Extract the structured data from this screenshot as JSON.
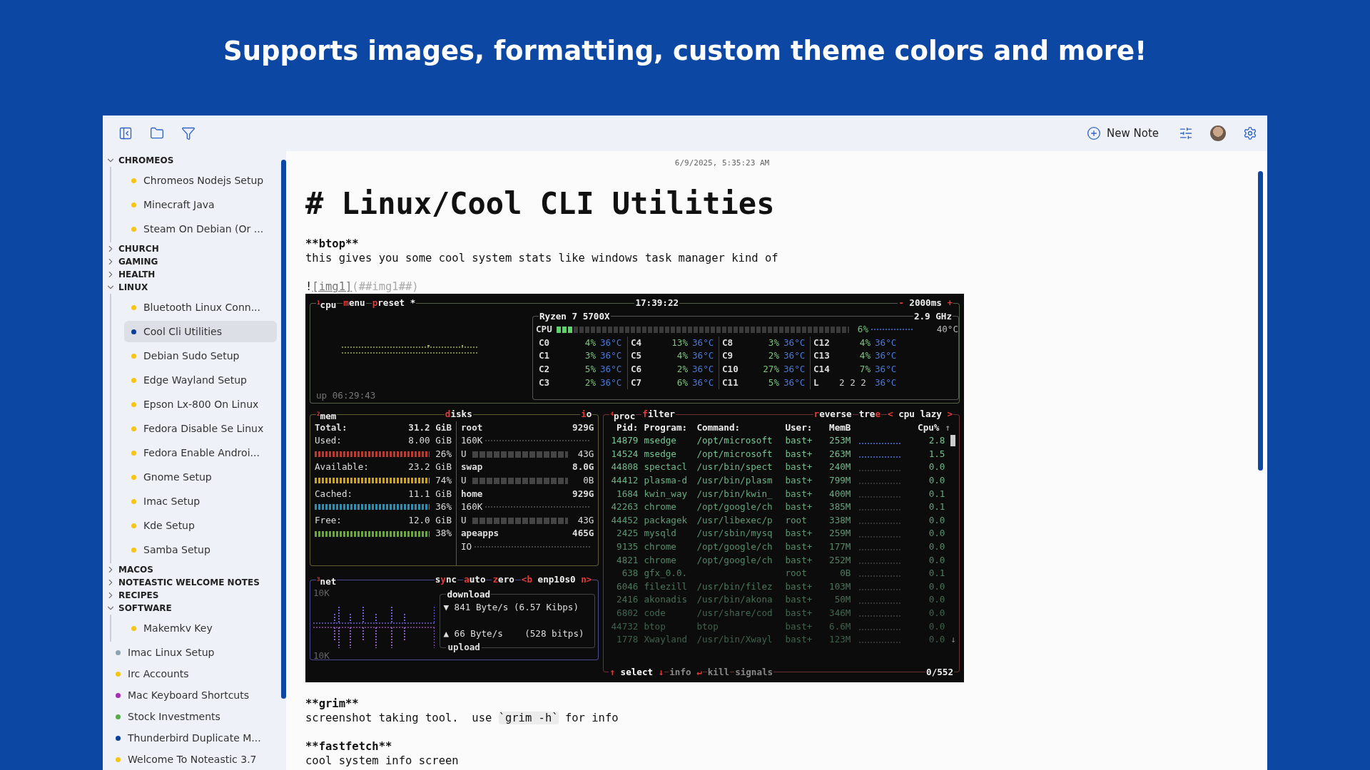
{
  "headline": "Supports images, formatting, custom theme colors and more!",
  "toolbar": {
    "new_note": "New Note"
  },
  "sidebar": {
    "items": [
      {
        "kind": "folder",
        "label": "CHROMEOS",
        "expanded": true,
        "children": [
          {
            "kind": "note",
            "label": "Chromeos Nodejs Setup",
            "color": "#f5c518",
            "selected": false
          },
          {
            "kind": "note",
            "label": "Minecraft Java",
            "color": "#f5c518",
            "selected": false
          },
          {
            "kind": "note",
            "label": "Steam On Debian (Or ...",
            "color": "#f5c518",
            "selected": false
          }
        ]
      },
      {
        "kind": "folder",
        "label": "CHURCH",
        "expanded": false
      },
      {
        "kind": "folder",
        "label": "GAMING",
        "expanded": false
      },
      {
        "kind": "folder",
        "label": "HEALTH",
        "expanded": false
      },
      {
        "kind": "folder",
        "label": "LINUX",
        "expanded": true,
        "children": [
          {
            "kind": "note",
            "label": "Bluetooth Linux Conn...",
            "color": "#f5c518",
            "selected": false
          },
          {
            "kind": "note",
            "label": "Cool Cli Utilities",
            "color": "#0d3f99",
            "selected": true
          },
          {
            "kind": "note",
            "label": "Debian Sudo Setup",
            "color": "#f5c518",
            "selected": false
          },
          {
            "kind": "note",
            "label": "Edge Wayland Setup",
            "color": "#f5c518",
            "selected": false
          },
          {
            "kind": "note",
            "label": "Epson Lx-800 On Linux",
            "color": "#f5c518",
            "selected": false
          },
          {
            "kind": "note",
            "label": "Fedora Disable Se Linux",
            "color": "#f5c518",
            "selected": false
          },
          {
            "kind": "note",
            "label": "Fedora Enable Androi...",
            "color": "#f5c518",
            "selected": false
          },
          {
            "kind": "note",
            "label": "Gnome Setup",
            "color": "#f5c518",
            "selected": false
          },
          {
            "kind": "note",
            "label": "Imac Setup",
            "color": "#f5c518",
            "selected": false
          },
          {
            "kind": "note",
            "label": "Kde Setup",
            "color": "#f5c518",
            "selected": false
          },
          {
            "kind": "note",
            "label": "Samba Setup",
            "color": "#f5c518",
            "selected": false
          }
        ]
      },
      {
        "kind": "folder",
        "label": "MACOS",
        "expanded": false
      },
      {
        "kind": "folder",
        "label": "NOTEASTIC WELCOME NOTES",
        "expanded": false
      },
      {
        "kind": "folder",
        "label": "RECIPES",
        "expanded": false
      },
      {
        "kind": "folder",
        "label": "SOFTWARE",
        "expanded": true,
        "children": [
          {
            "kind": "note",
            "label": "Makemkv Key",
            "color": "#f5c518",
            "selected": false
          }
        ]
      },
      {
        "kind": "note",
        "label": "Imac Linux Setup",
        "color": "#8fa3b3",
        "selected": false
      },
      {
        "kind": "note",
        "label": "Irc Accounts",
        "color": "#f5c518",
        "selected": false
      },
      {
        "kind": "note",
        "label": "Mac Keyboard Shortcuts",
        "color": "#a52fb5",
        "selected": false
      },
      {
        "kind": "note",
        "label": "Stock Investments",
        "color": "#5aaa4a",
        "selected": false
      },
      {
        "kind": "note",
        "label": "Thunderbird Duplicate M...",
        "color": "#0d3f99",
        "selected": false
      },
      {
        "kind": "note",
        "label": "Welcome To Noteastic 3.7",
        "color": "#f5c518",
        "selected": false
      }
    ]
  },
  "note": {
    "timestamp": "6/9/2025, 5:35:23 AM",
    "title": "# Linux/Cool CLI Utilities",
    "blocks": [
      {
        "kind": "bold",
        "text": "**btop**"
      },
      {
        "kind": "text",
        "text": "this gives you some cool system stats like windows task manager kind of"
      },
      {
        "kind": "gap"
      },
      {
        "kind": "image_link",
        "bang": "!",
        "alt": "[img1]",
        "target": "(##img1##)"
      },
      {
        "kind": "terminal"
      },
      {
        "kind": "gap"
      },
      {
        "kind": "bold",
        "text": "**grim**"
      },
      {
        "kind": "code_text",
        "before": "screenshot taking tool.  use ",
        "code": "`grim -h`",
        "after": " for info"
      },
      {
        "kind": "gap"
      },
      {
        "kind": "bold",
        "text": "**fastfetch**"
      },
      {
        "kind": "text",
        "text": "cool system info screen"
      }
    ]
  },
  "terminal": {
    "cpu": {
      "tabs": [
        "$^{1}$cpu",
        "**m**enu",
        "**p**reset *"
      ],
      "clock": "17:39:22",
      "interval": "**-** 2000ms **+**",
      "uptime": "up 06:29:43",
      "model": "Ryzen 7 5700X",
      "freq": "2.9 GHz",
      "total": {
        "label": "CPU",
        "level": 0.06,
        "percent": "6%",
        "temp": "40°C"
      },
      "core_rows": [
        [
          {
            "kind": "core",
            "name": "C0",
            "percent": "4%",
            "temp": "36°C"
          },
          {
            "kind": "core",
            "name": "C4",
            "percent": "13%",
            "temp": "36°C"
          },
          {
            "kind": "core",
            "name": "C8",
            "percent": "3%",
            "temp": "36°C"
          },
          {
            "kind": "core",
            "name": "C12",
            "percent": "4%",
            "temp": "36°C"
          }
        ],
        [
          {
            "kind": "core",
            "name": "C1",
            "percent": "3%",
            "temp": "36°C"
          },
          {
            "kind": "core",
            "name": "C5",
            "percent": "4%",
            "temp": "36°C"
          },
          {
            "kind": "core",
            "name": "C9",
            "percent": "2%",
            "temp": "36°C"
          },
          {
            "kind": "core",
            "name": "C13",
            "percent": "4%",
            "temp": "36°C"
          }
        ],
        [
          {
            "kind": "core",
            "name": "C2",
            "percent": "5%",
            "temp": "36°C"
          },
          {
            "kind": "core",
            "name": "C6",
            "percent": "2%",
            "temp": "36°C"
          },
          {
            "kind": "core",
            "name": "C10",
            "percent": "27%",
            "temp": "36°C"
          },
          {
            "kind": "core",
            "name": "C14",
            "percent": "7%",
            "temp": "36°C"
          }
        ],
        [
          {
            "kind": "core",
            "name": "C3",
            "percent": "2%",
            "temp": "36°C"
          },
          {
            "kind": "core",
            "name": "C7",
            "percent": "6%",
            "temp": "36°C"
          },
          {
            "kind": "core",
            "name": "C11",
            "percent": "5%",
            "temp": "36°C"
          },
          {
            "kind": "load",
            "name": "L",
            "percent": "2 2 2",
            "temp": "36°C"
          }
        ]
      ]
    },
    "mem": {
      "title": "$^{2}$mem",
      "disks_title": "**d**isks",
      "io_title": "**i**o",
      "rows": [
        {
          "kind": "total",
          "label": "Total:",
          "value": "31.2 GiB"
        },
        {
          "kind": "meter",
          "label": "Used:",
          "value": "8.00 GiB",
          "percent": "26%",
          "color": "#c0392b"
        },
        {
          "kind": "meter",
          "label": "Available:",
          "value": "23.2 GiB",
          "percent": "74%",
          "color": "#c9a227"
        },
        {
          "kind": "meter",
          "label": "Cached:",
          "value": "11.1 GiB",
          "percent": "36%",
          "color": "#2f8fb0"
        },
        {
          "kind": "meter",
          "label": "Free:",
          "value": "12.0 GiB",
          "percent": "38%",
          "color": "#6aa83a"
        }
      ],
      "disks": [
        {
          "name": "root",
          "size": "929G",
          "io": "160K",
          "used_label": "U",
          "used": "43G"
        },
        {
          "name": "swap",
          "size": "8.0G",
          "used_label": "U",
          "used": "0B"
        },
        {
          "name": "home",
          "size": "929G",
          "io": "160K",
          "used_label": "U",
          "used": "43G"
        },
        {
          "name": "apeapps",
          "size": "465G",
          "io": "IO"
        }
      ]
    },
    "net": {
      "tabs": [
        "$^{3}$net",
        "s**y**nc",
        "**a**uto",
        "**z**ero",
        "**<b** enp10s0 **n>**"
      ],
      "scale_top": "10K",
      "scale_bottom": "10K",
      "download_title": "download",
      "upload_title": "upload",
      "download": "▼ 841 Byte/s (6.57 Kibps)",
      "upload": "▲ 66 Byte/s    (528 bitps)"
    },
    "proc": {
      "tabs": [
        "$^{4}$proc",
        "**f**ilter",
        "**r**everse",
        "tre**e**",
        "**<** cpu lazy **>**"
      ],
      "columns": [
        "Pid:",
        "Program:",
        "Command:",
        "User:",
        "MemB",
        "Cpu%",
        "↑"
      ],
      "rows": [
        [
          "14879",
          "msedge",
          "/opt/microsoft",
          "bast+",
          "253M",
          "2.8"
        ],
        [
          "14524",
          "msedge",
          "/opt/microsoft",
          "bast+",
          "263M",
          "1.5"
        ],
        [
          "44808",
          "spectacl",
          "/usr/bin/spect",
          "bast+",
          "240M",
          "0.0"
        ],
        [
          "44412",
          "plasma-d",
          "/usr/bin/plasm",
          "bast+",
          "799M",
          "0.0"
        ],
        [
          "1684",
          "kwin_way",
          "/usr/bin/kwin_",
          "bast+",
          "400M",
          "0.1"
        ],
        [
          "42263",
          "chrome",
          "/opt/google/ch",
          "bast+",
          "385M",
          "0.1"
        ],
        [
          "44452",
          "packagek",
          "/usr/libexec/p",
          "root",
          "338M",
          "0.0"
        ],
        [
          "2425",
          "mysqld",
          "/usr/sbin/mysq",
          "bast+",
          "259M",
          "0.0"
        ],
        [
          "9135",
          "chrome",
          "/opt/google/ch",
          "bast+",
          "177M",
          "0.0"
        ],
        [
          "4821",
          "chrome",
          "/opt/google/ch",
          "bast+",
          "252M",
          "0.0"
        ],
        [
          "638",
          "gfx_0.0.",
          "",
          "root",
          "0B",
          "0.1"
        ],
        [
          "6046",
          "filezill",
          "/usr/bin/filez",
          "bast+",
          "103M",
          "0.0"
        ],
        [
          "2416",
          "akonadis",
          "/usr/bin/akona",
          "bast+",
          "50M",
          "0.0"
        ],
        [
          "6802",
          "code",
          "/usr/share/cod",
          "bast+",
          "346M",
          "0.0"
        ],
        [
          "44732",
          "btop",
          "btop",
          "bast+",
          "6.6M",
          "0.0"
        ],
        [
          "1778",
          "Xwayland",
          "/usr/bin/Xwayl",
          "bast+",
          "123M",
          "0.0"
        ]
      ],
      "scroll_down": "↓",
      "footer": [
        {
          "label": "**↑** select **↓**",
          "active": true
        },
        {
          "label": "info **↵**",
          "active": false
        },
        {
          "label": "kill",
          "active": false
        },
        {
          "label": "signals",
          "active": false
        }
      ],
      "count": "0/552"
    }
  }
}
